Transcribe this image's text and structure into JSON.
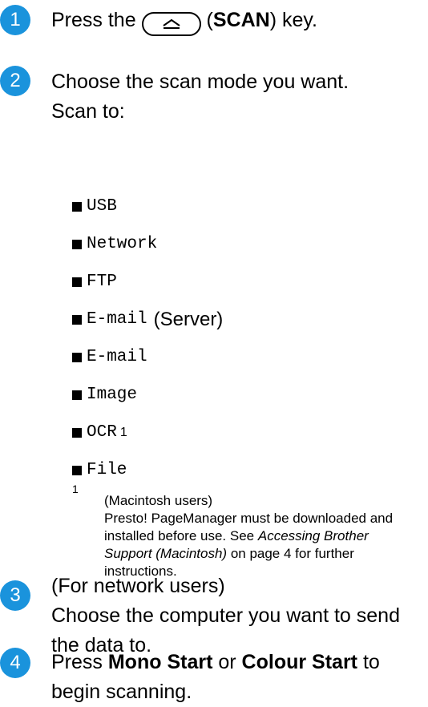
{
  "steps": [
    {
      "number": "1",
      "text_pre": "Press the",
      "key_label": "SCAN",
      "text_post": "key."
    },
    {
      "number": "2",
      "line1": "Choose the scan mode you want.",
      "line2": "Scan to:"
    },
    {
      "number": "3",
      "line1": "(For network users)",
      "line2": "Choose the computer you want to send",
      "line3": "the data to."
    },
    {
      "number": "4",
      "text_pre": "Press",
      "bold1": "Mono Start",
      "text_mid": "or",
      "bold2": "Colour Start",
      "text_post": "to",
      "line2": "begin scanning."
    }
  ],
  "scan_targets": [
    "USB",
    "Network",
    "FTP",
    "E-mail",
    "E-mail",
    "Image",
    "OCR",
    "File"
  ],
  "scan_targets_extra": {
    "email_server_suffix": "(Server)",
    "ocr_footnote": "1"
  },
  "footnote": {
    "marker": "1",
    "line1": "(Macintosh users)",
    "text_a": "Presto! PageManager must be downloaded and installed before use. See",
    "link": "Accessing Brother Support (Macintosh)",
    "text_b": "on page 4 for further instructions."
  },
  "colors": {
    "accent": "#1a93dc"
  }
}
